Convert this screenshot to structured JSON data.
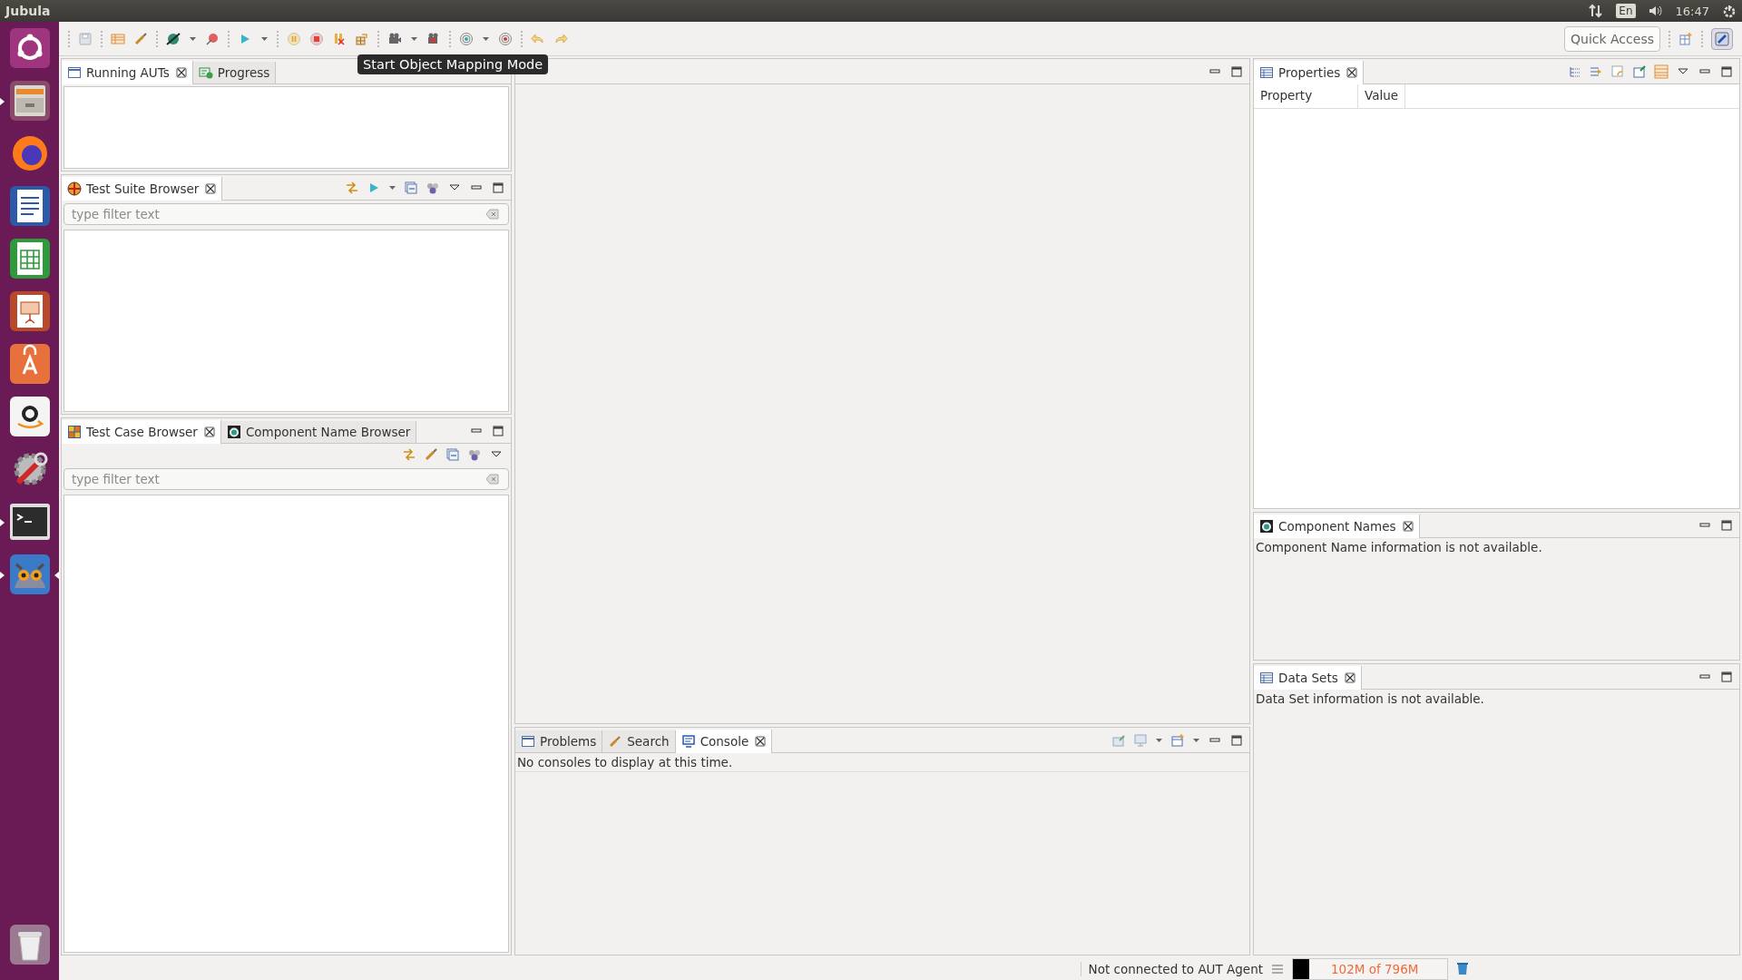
{
  "top_bar": {
    "app_name": "Jubula",
    "keyboard_layout": "En",
    "time": "16:47"
  },
  "launcher": [
    {
      "kind": "dash",
      "running": false,
      "focused": false
    },
    {
      "kind": "files",
      "running": true,
      "focused": false
    },
    {
      "kind": "browser",
      "running": false,
      "focused": false
    },
    {
      "kind": "writer",
      "running": false,
      "focused": false
    },
    {
      "kind": "calc",
      "running": false,
      "focused": false
    },
    {
      "kind": "impress",
      "running": false,
      "focused": false
    },
    {
      "kind": "store",
      "running": false,
      "focused": false
    },
    {
      "kind": "amazon",
      "running": false,
      "focused": false
    },
    {
      "kind": "settings",
      "running": false,
      "focused": false
    },
    {
      "kind": "terminal",
      "running": true,
      "focused": false
    },
    {
      "kind": "jubula",
      "running": true,
      "focused": true
    },
    {
      "kind": "trash",
      "running": false,
      "focused": false
    }
  ],
  "toolbar": {
    "quick_access": {
      "placeholder": "Quick Access"
    }
  },
  "tooltip": "Start Object Mapping Mode",
  "left": {
    "auts": {
      "tabs": [
        {
          "label": "Running AUTs",
          "kind": "window",
          "selected": true
        },
        {
          "label": "Progress",
          "kind": "progress",
          "selected": false
        }
      ]
    },
    "test_suites": {
      "tabs": [
        {
          "label": "Test Suite Browser",
          "kind": "suite",
          "selected": true
        }
      ],
      "filter": {
        "placeholder": "type filter text"
      }
    },
    "test_cases": {
      "tabs": [
        {
          "label": "Test Case Browser",
          "kind": "testcase",
          "selected": true
        },
        {
          "label": "Component Name Browser",
          "kind": "component",
          "selected": false
        }
      ],
      "filter": {
        "placeholder": "type filter text"
      }
    }
  },
  "center": {
    "console": {
      "tabs": [
        {
          "label": "Problems",
          "kind": "window",
          "selected": false
        },
        {
          "label": "Search",
          "kind": "search",
          "selected": false
        },
        {
          "label": "Console",
          "kind": "console",
          "selected": true
        }
      ],
      "message": "No consoles to display at this time."
    }
  },
  "right": {
    "properties": {
      "tabs": [
        {
          "label": "Properties",
          "kind": "properties",
          "selected": true
        }
      ],
      "columns": [
        "Property",
        "Value"
      ]
    },
    "component_names": {
      "tabs": [
        {
          "label": "Component Names",
          "kind": "component",
          "selected": true
        }
      ],
      "message": "Component Name information is not available."
    },
    "data_sets": {
      "tabs": [
        {
          "label": "Data Sets",
          "kind": "properties",
          "selected": true
        }
      ],
      "message": "Data Set information is not available."
    }
  },
  "status_bar": {
    "connection": "Not connected to AUT Agent",
    "memory": "102M of 796M"
  }
}
